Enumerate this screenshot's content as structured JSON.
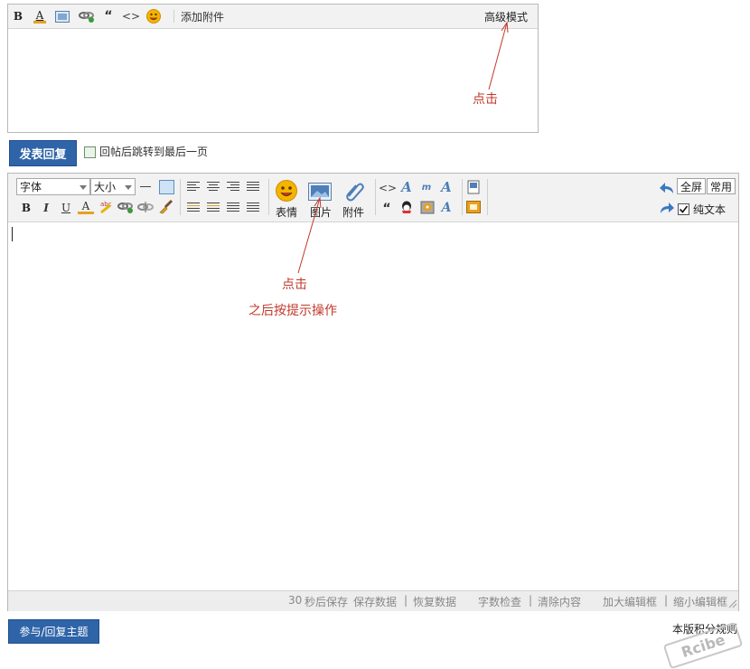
{
  "simple_editor": {
    "toolbar": {
      "bold": "B",
      "font_color": "A",
      "quote": "“",
      "code": "<>",
      "add_attachment": "添加附件",
      "advanced_mode": "高级模式"
    }
  },
  "reply": {
    "submit_label": "发表回复",
    "jump_label": "回帖后跳转到最后一页"
  },
  "adv_editor": {
    "font_select": "字体",
    "size_select": "大小",
    "bold": "B",
    "italic": "I",
    "underline": "U",
    "font_color": "A",
    "quote": "“",
    "code": "<>",
    "emotion_label": "表情",
    "image_label": "图片",
    "attach_label": "附件",
    "fullscreen_label": "全屏",
    "common_label": "常用",
    "plaintext_label": "纯文本",
    "status": {
      "autosave_seconds": "30",
      "autosave_text": "秒后保存",
      "save_data": "保存数据",
      "restore_data": "恢复数据",
      "word_check": "字数检查",
      "clear_content": "清除内容",
      "enlarge": "加大编辑框",
      "shrink": "缩小编辑框"
    }
  },
  "annotations": {
    "click_1": "点击",
    "click_2": "点击",
    "hint": "之后按提示操作"
  },
  "footer": {
    "join_label": "参与/回复主题",
    "copyright": "本版积分规则",
    "watermark": "Rcibe"
  },
  "colors": {
    "button_blue": "#2f64a8",
    "annotation_red": "#c0392b"
  }
}
